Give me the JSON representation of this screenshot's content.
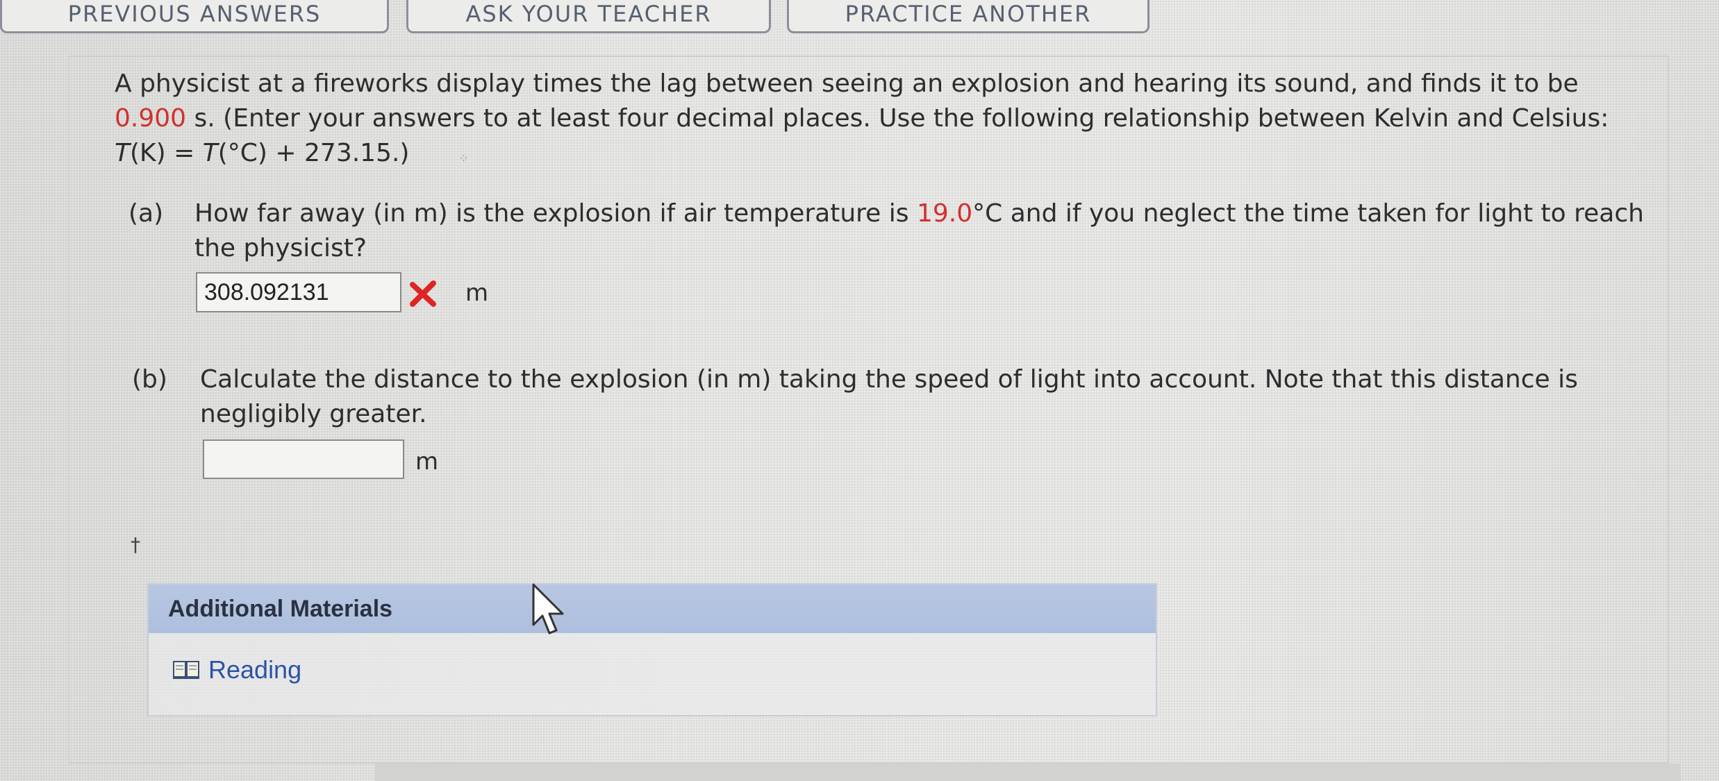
{
  "nav": {
    "prev_answers": "PREVIOUS ANSWERS",
    "ask_teacher": "ASK YOUR TEACHER",
    "practice_another": "PRACTICE ANOTHER"
  },
  "problem": {
    "intro_line1": "A physicist at a fireworks display times the lag between seeing an explosion and hearing its sound, and finds it to be",
    "lag_value": "0.900",
    "intro_line2_rest": " s. (Enter your answers to at least four decimal places. Use the following relationship between Kelvin and Celsius:",
    "formula_T1": "T",
    "formula_part1": "(K) = ",
    "formula_T2": "T",
    "formula_part2": "(°C) + 273.15.)"
  },
  "part_a": {
    "label": "(a)",
    "line1_before": "How far away (in m) is the explosion if air temperature is ",
    "temperature": "19.0",
    "line1_after": "°C and if you neglect the time taken for light to reach",
    "line2": "the physicist?",
    "answer_value": "308.092131",
    "unit": "m",
    "status": "incorrect"
  },
  "part_b": {
    "label": "(b)",
    "line1": "Calculate the distance to the explosion (in m) taking the speed of light into account. Note that this distance is",
    "line2": "negligibly greater.",
    "answer_value": "",
    "unit": "m"
  },
  "dagger": "†",
  "materials": {
    "header": "Additional Materials",
    "reading_label": "Reading"
  },
  "colors": {
    "highlight_red": "#d0312d",
    "header_blue": "#b0c1df",
    "link_blue": "#2a54a8"
  }
}
